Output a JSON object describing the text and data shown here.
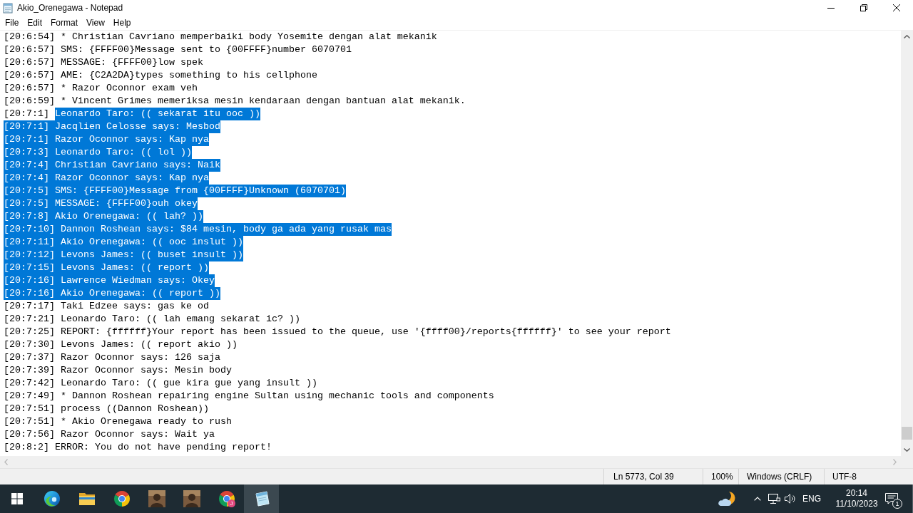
{
  "window": {
    "title": "Akio_Orenegawa - Notepad"
  },
  "menu": [
    "File",
    "Edit",
    "Format",
    "View",
    "Help"
  ],
  "editor": {
    "lines": [
      {
        "segments": [
          {
            "text": "[20:6:54] * Christian Cavriano memperbaiki body Yosemite dengan alat mekanik",
            "selected": false
          }
        ]
      },
      {
        "segments": [
          {
            "text": "[20:6:57] SMS: {FFFF00}Message sent to {00FFFF}number 6070701",
            "selected": false
          }
        ]
      },
      {
        "segments": [
          {
            "text": "[20:6:57] MESSAGE: {FFFF00}low spek",
            "selected": false
          }
        ]
      },
      {
        "segments": [
          {
            "text": "[20:6:57] AME: {C2A2DA}types something to his cellphone",
            "selected": false
          }
        ]
      },
      {
        "segments": [
          {
            "text": "[20:6:57] * Razor Oconnor exam veh",
            "selected": false
          }
        ]
      },
      {
        "segments": [
          {
            "text": "[20:6:59] * Vincent Grimes memeriksa mesin kendaraan dengan bantuan alat mekanik.",
            "selected": false
          }
        ]
      },
      {
        "segments": [
          {
            "text": "[20:7:1] ",
            "selected": false
          },
          {
            "text": "Leonardo Taro: (( sekarat itu ooc ))",
            "selected": true
          }
        ]
      },
      {
        "segments": [
          {
            "text": "[20:7:1] Jacqlien Celosse says: Mesbod",
            "selected": true
          }
        ]
      },
      {
        "segments": [
          {
            "text": "[20:7:1] Razor Oconnor says: Kap nya",
            "selected": true
          }
        ]
      },
      {
        "segments": [
          {
            "text": "[20:7:3] Leonardo Taro: (( lol ))",
            "selected": true
          }
        ]
      },
      {
        "segments": [
          {
            "text": "[20:7:4] Christian Cavriano says: Naik",
            "selected": true
          }
        ]
      },
      {
        "segments": [
          {
            "text": "[20:7:4] Razor Oconnor says: Kap nya",
            "selected": true
          }
        ]
      },
      {
        "segments": [
          {
            "text": "[20:7:5] SMS: {FFFF00}Message from {00FFFF}Unknown (6070701)",
            "selected": true
          }
        ]
      },
      {
        "segments": [
          {
            "text": "[20:7:5] MESSAGE: {FFFF00}ouh okey",
            "selected": true
          }
        ]
      },
      {
        "segments": [
          {
            "text": "[20:7:8] Akio Orenegawa: (( lah? ))",
            "selected": true
          }
        ]
      },
      {
        "segments": [
          {
            "text": "[20:7:10] Dannon Roshean says: $84 mesin, body ga ada yang rusak mas",
            "selected": true
          }
        ]
      },
      {
        "segments": [
          {
            "text": "[20:7:11] Akio Orenegawa: (( ooc inslut ))",
            "selected": true
          }
        ]
      },
      {
        "segments": [
          {
            "text": "[20:7:12] Levons James: (( buset insult ))",
            "selected": true
          }
        ]
      },
      {
        "segments": [
          {
            "text": "[20:7:15] Levons James: (( report ))",
            "selected": true
          }
        ]
      },
      {
        "segments": [
          {
            "text": "[20:7:16] Lawrence Wiedman says: Okey",
            "selected": true
          }
        ]
      },
      {
        "segments": [
          {
            "text": "[20:7:16] Akio Orenegawa: (( report ))",
            "selected": true
          }
        ]
      },
      {
        "segments": [
          {
            "text": "[20:7:17] Taki Edzee says: gas ke od",
            "selected": false
          }
        ]
      },
      {
        "segments": [
          {
            "text": "[20:7:21] Leonardo Taro: (( lah emang sekarat ic? ))",
            "selected": false
          }
        ]
      },
      {
        "segments": [
          {
            "text": "[20:7:25] REPORT: {ffffff}Your report has been issued to the queue, use '{ffff00}/reports{ffffff}' to see your report",
            "selected": false
          }
        ]
      },
      {
        "segments": [
          {
            "text": "[20:7:30] Levons James: (( report akio ))",
            "selected": false
          }
        ]
      },
      {
        "segments": [
          {
            "text": "[20:7:37] Razor Oconnor says: 126 saja",
            "selected": false
          }
        ]
      },
      {
        "segments": [
          {
            "text": "[20:7:39] Razor Oconnor says: Mesin body",
            "selected": false
          }
        ]
      },
      {
        "segments": [
          {
            "text": "[20:7:42] Leonardo Taro: (( gue kira gue yang insult ))",
            "selected": false
          }
        ]
      },
      {
        "segments": [
          {
            "text": "[20:7:49] * Dannon Roshean repairing engine Sultan using mechanic tools and components",
            "selected": false
          }
        ]
      },
      {
        "segments": [
          {
            "text": "[20:7:51] process ((Dannon Roshean))",
            "selected": false
          }
        ]
      },
      {
        "segments": [
          {
            "text": "[20:7:51] * Akio Orenegawa ready to rush",
            "selected": false
          }
        ]
      },
      {
        "segments": [
          {
            "text": "[20:7:56] Razor Oconnor says: Wait ya",
            "selected": false
          }
        ]
      },
      {
        "segments": [
          {
            "text": "[20:8:2] ERROR: You do not have pending report!",
            "selected": false
          }
        ]
      }
    ]
  },
  "status_bar": {
    "position": "Ln 5773, Col 39",
    "zoom": "100%",
    "line_ending": "Windows (CRLF)",
    "encoding": "UTF-8"
  },
  "taskbar": {
    "apps": [
      {
        "kind": "edge",
        "active": false
      },
      {
        "kind": "explorer",
        "active": false
      },
      {
        "kind": "chrome",
        "active": false
      },
      {
        "kind": "game",
        "active": false
      },
      {
        "kind": "game",
        "active": false
      },
      {
        "kind": "chrome",
        "active": false,
        "badge": "J"
      },
      {
        "kind": "notepad",
        "active": true
      }
    ],
    "tray": {
      "language": "ENG",
      "time": "20:14",
      "date": "11/10/2023",
      "notifications": "1"
    }
  }
}
